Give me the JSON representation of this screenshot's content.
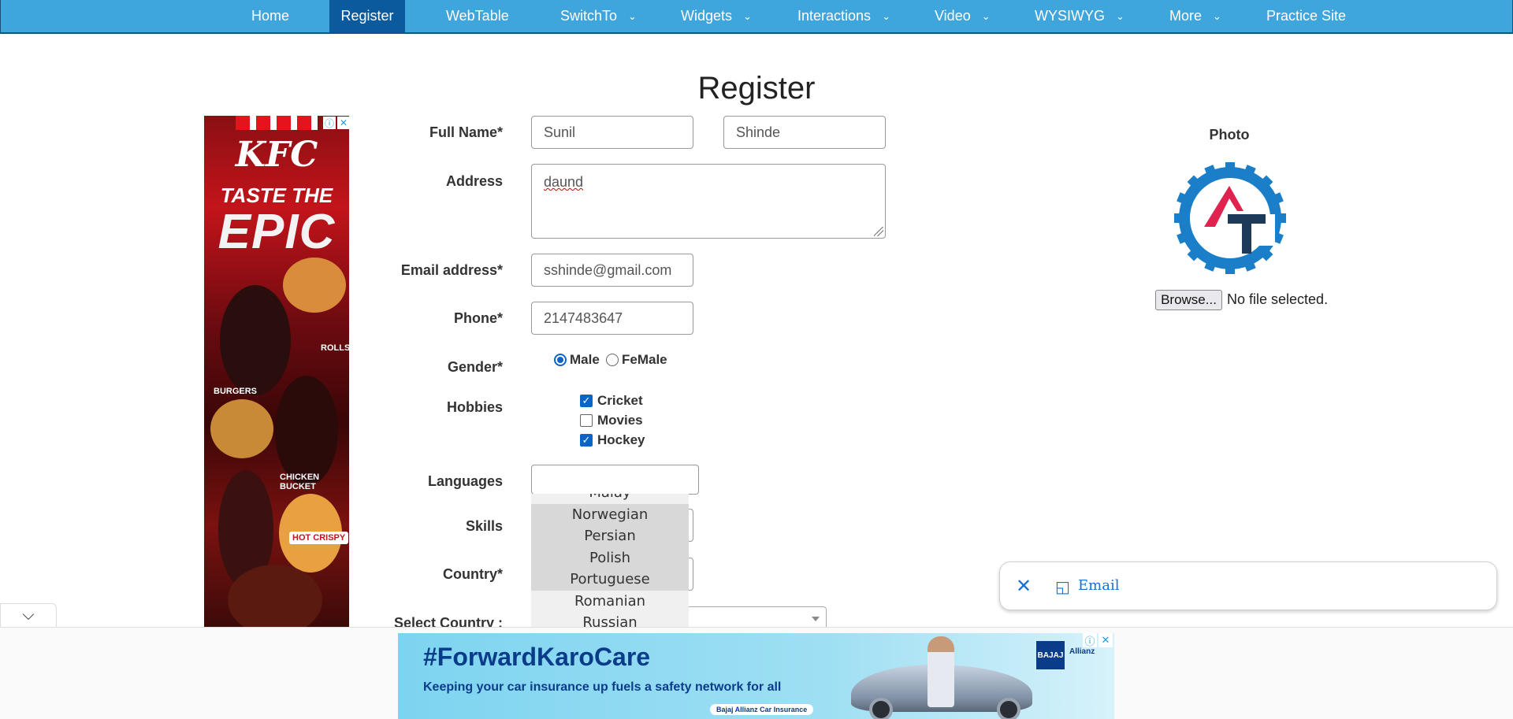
{
  "nav": {
    "items": [
      {
        "label": "Home",
        "has_menu": false
      },
      {
        "label": "Register",
        "has_menu": false,
        "active": true
      },
      {
        "label": "WebTable",
        "has_menu": false
      },
      {
        "label": "SwitchTo",
        "has_menu": true
      },
      {
        "label": "Widgets",
        "has_menu": true
      },
      {
        "label": "Interactions",
        "has_menu": true
      },
      {
        "label": "Video",
        "has_menu": true
      },
      {
        "label": "WYSIWYG",
        "has_menu": true
      },
      {
        "label": "More",
        "has_menu": true
      },
      {
        "label": "Practice Site",
        "has_menu": false
      }
    ],
    "dropdown_icon": "chevron-down-icon",
    "bg_color": "#3fa5dd",
    "active_color": "#0b5a9e"
  },
  "page": {
    "title": "Register"
  },
  "form": {
    "full_name": {
      "label": "Full Name*",
      "first": "Sunil",
      "last": "Shinde"
    },
    "address": {
      "label": "Address",
      "value": "daund"
    },
    "email": {
      "label": "Email address*",
      "value": "sshinde@gmail.com"
    },
    "phone": {
      "label": "Phone*",
      "value": "2147483647"
    },
    "gender": {
      "label": "Gender*",
      "options": [
        "Male",
        "FeMale"
      ],
      "selected": "Male"
    },
    "hobbies": {
      "label": "Hobbies",
      "options": [
        {
          "label": "Cricket",
          "checked": true
        },
        {
          "label": "Movies",
          "checked": false
        },
        {
          "label": "Hockey",
          "checked": true
        }
      ]
    },
    "languages": {
      "label": "Languages",
      "value": "",
      "list": [
        "Malay",
        "Norwegian",
        "Persian",
        "Polish",
        "Portuguese",
        "Romanian",
        "Russian"
      ],
      "highlighted": [
        "Norwegian",
        "Persian",
        "Polish",
        "Portuguese"
      ]
    },
    "skills": {
      "label": "Skills"
    },
    "country": {
      "label": "Country*"
    },
    "select_country": {
      "label": "Select Country :"
    }
  },
  "photo": {
    "label": "Photo",
    "browse_label": "Browse...",
    "file_status": "No file selected.",
    "logo_colors": {
      "gear": "#1a7fc8",
      "a": "#e0224f",
      "t": "#1e3a5a"
    }
  },
  "ads": {
    "left": {
      "brand": "KFC",
      "line1": "TASTE THE",
      "line2": "EPIC",
      "tags": [
        "ROLLS",
        "BURGERS",
        "CHICKEN BUCKET"
      ],
      "bucket_text": "HOT CRISPY"
    },
    "bottom": {
      "headline": "#ForwardKaroCare",
      "subline": "Keeping your car insurance up fuels a safety network for all",
      "pill": "Bajaj Allianz Car Insurance",
      "brand": "BAJAJ",
      "partner": "Allianz"
    },
    "info_icon": "info-icon",
    "close_icon": "close-icon"
  },
  "email_pill": {
    "label": "Email",
    "close_icon": "close-icon",
    "device_icon": "devices-icon"
  },
  "bottom": {
    "collapse_icon": "chevron-down-icon"
  }
}
